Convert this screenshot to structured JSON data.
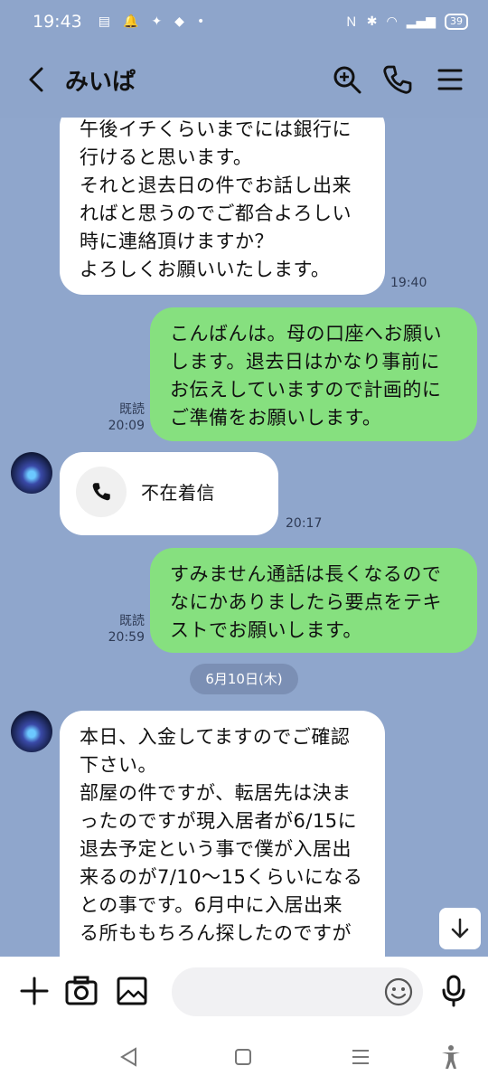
{
  "status_bar": {
    "time": "19:43",
    "battery": "39"
  },
  "header": {
    "title": "みいぱ",
    "icons": [
      "back-icon",
      "search-icon",
      "phone-icon",
      "menu-icon"
    ]
  },
  "messages": [
    {
      "direction": "in",
      "lines": [
        "午後イチくらいまでには銀行に",
        "行けると思います。",
        "それと退去日の件でお話し出来",
        "ればと思うのでご都合よろしい",
        "時に連絡頂けますか？",
        "よろしくお願いいたします。"
      ],
      "time": "19:40"
    },
    {
      "direction": "out",
      "lines": [
        "こんばんは。母の口座へお願い",
        "します。退去日はかなり事前に",
        "お伝えしていますので計画的に",
        "ご準備をお願いします。"
      ],
      "read": "既読",
      "time": "20:09"
    },
    {
      "direction": "in",
      "type": "call",
      "label": "不在着信",
      "time": "20:17"
    },
    {
      "direction": "out",
      "lines": [
        "すみません通話は長くなるので",
        "なにかありましたら要点をテキ",
        "ストでお願いします。"
      ],
      "read": "既読",
      "time": "20:59"
    },
    {
      "direction": "in",
      "lines": [
        "本日、入金してますのでご確認",
        "下さい。",
        "部屋の件ですが、転居先は決ま",
        "ったのですが現入居者が6/15に",
        "退去予定という事で僕が入居出",
        "来るのが7/10〜15くらいになる",
        "との事です。6月中に入居出来",
        "る所ももちろん探したのですが"
      ]
    }
  ],
  "date_separator": "6月10日(木)",
  "input": {
    "placeholder": ""
  },
  "colors": {
    "background": "#8fa6cc",
    "outgoing_bubble": "#86e07f",
    "incoming_bubble": "#ffffff"
  }
}
